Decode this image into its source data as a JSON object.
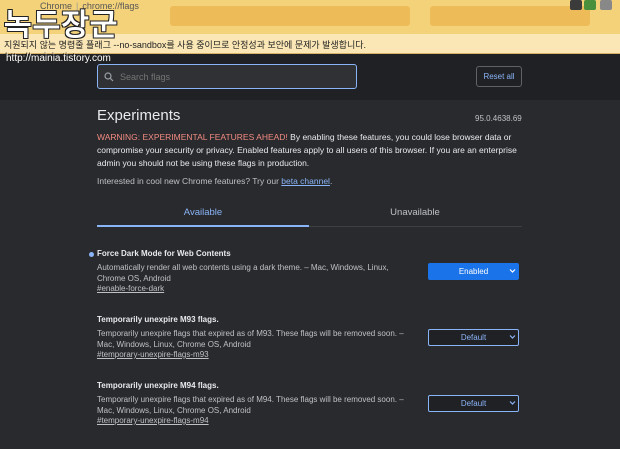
{
  "browser": {
    "tab_title": "Chrome",
    "address": "chrome://flags"
  },
  "watermark": {
    "title": "녹두장군",
    "url": "http://mainia.tistory.com"
  },
  "infobar": {
    "text": "지원되지 않는 명령줄 플래그 --no-sandbox를 사용 중이므로 안정성과 보안에 문제가 발생합니다."
  },
  "search": {
    "placeholder": "Search flags"
  },
  "reset_label": "Reset all",
  "page": {
    "title": "Experiments",
    "version": "95.0.4638.69",
    "warning_label": "WARNING: EXPERIMENTAL FEATURES AHEAD!",
    "warning_text": " By enabling these features, you could lose browser data or compromise your security or privacy. Enabled features apply to all users of this browser. If you are an enterprise admin you should not be using these flags in production.",
    "interest_text": "Interested in cool new Chrome features? Try our ",
    "interest_link": "beta channel",
    "interest_end": "."
  },
  "tabs": [
    {
      "label": "Available"
    },
    {
      "label": "Unavailable"
    }
  ],
  "flags": [
    {
      "name": "Force Dark Mode for Web Contents",
      "description": "Automatically render all web contents using a dark theme. – Mac, Windows, Linux, Chrome OS, Android",
      "link": "#enable-force-dark",
      "value": "Enabled"
    },
    {
      "name": "Temporarily unexpire M93 flags.",
      "description": "Temporarily unexpire flags that expired as of M93. These flags will be removed soon. – Mac, Windows, Linux, Chrome OS, Android",
      "link": "#temporary-unexpire-flags-m93",
      "value": "Default"
    },
    {
      "name": "Temporarily unexpire M94 flags.",
      "description": "Temporarily unexpire flags that expired as of M94. These flags will be removed soon. – Mac, Windows, Linux, Chrome OS, Android",
      "link": "#temporary-unexpire-flags-m94",
      "value": "Default"
    }
  ],
  "colors": {
    "background": "#202124",
    "accent": "#8ab4f8",
    "enabled_button": "#1a73e8",
    "warning_red": "#f28b82",
    "infobar": "#fbe7b6"
  }
}
